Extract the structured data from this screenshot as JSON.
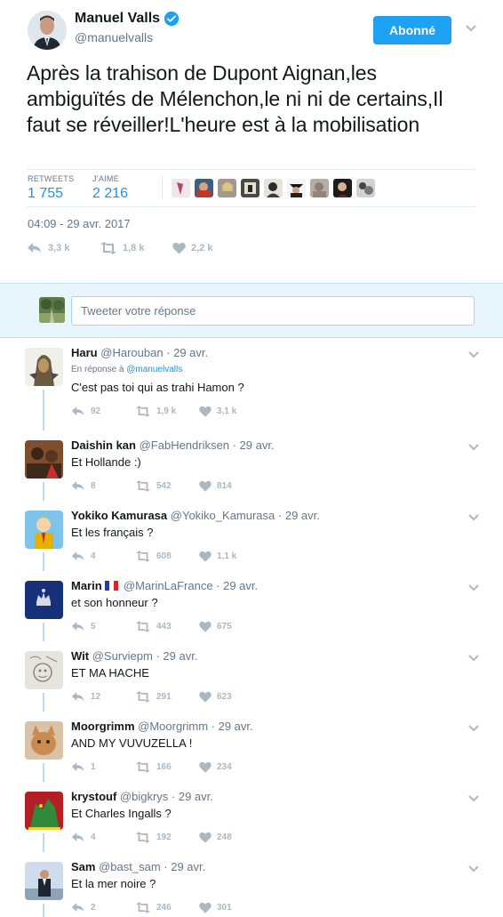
{
  "main_tweet": {
    "author": {
      "name": "Manuel Valls",
      "handle": "@manuelvalls"
    },
    "follow_label": "Abonné",
    "text": "Après la trahison de Dupont Aignan,les ambiguïtés de Mélenchon,le ni ni de certains,Il faut se réveiller!L'heure est à la mobilisation",
    "stats": {
      "retweets_label": "RETWEETS",
      "retweets_value": "1 755",
      "likes_label": "J'AIME",
      "likes_value": "2 216"
    },
    "timestamp": "04:09 - 29 avr. 2017",
    "actions": {
      "reply": "3,3 k",
      "retweet": "1,8 k",
      "like": "2,2 k"
    }
  },
  "reply_box": {
    "placeholder": "Tweeter votre réponse"
  },
  "replies": [
    {
      "name": "Haru",
      "handle": "@Harouban",
      "sep": " · ",
      "date": "29 avr.",
      "in_reply_prefix": "En réponse à ",
      "in_reply_handle": "@manuelvalls",
      "text": "C'est pas toi qui as trahi Hamon ?",
      "reply_count": "92",
      "retweet_count": "1,9 k",
      "like_count": "3,1 k"
    },
    {
      "name": "Daishin kan",
      "handle": "@FabHendriksen",
      "sep": " · ",
      "date": "29 avr.",
      "text": "Et Hollande :)",
      "reply_count": "8",
      "retweet_count": "542",
      "like_count": "814"
    },
    {
      "name": "Yokiko Kamurasa",
      "handle": "@Yokiko_Kamurasa",
      "sep": " · ",
      "date": "29 avr.",
      "text": "Et les français ?",
      "reply_count": "4",
      "retweet_count": "608",
      "like_count": "1,1 k"
    },
    {
      "name": "Marin",
      "handle": "@MarinLaFrance",
      "sep": " · ",
      "date": "29 avr.",
      "text": "et son honneur ?",
      "reply_count": "5",
      "retweet_count": "443",
      "like_count": "675"
    },
    {
      "name": "Wit",
      "handle": "@Surviepm",
      "sep": " · ",
      "date": "29 avr.",
      "text": "ET MA HACHE",
      "reply_count": "12",
      "retweet_count": "291",
      "like_count": "623"
    },
    {
      "name": "Moorgrimm",
      "handle": "@Moorgrimm",
      "sep": " · ",
      "date": "29 avr.",
      "text": "AND MY VUVUZELLA !",
      "reply_count": "1",
      "retweet_count": "166",
      "like_count": "234"
    },
    {
      "name": "krystouf",
      "handle": "@bigkrys",
      "sep": " · ",
      "date": "29 avr.",
      "text": "Et Charles Ingalls ?",
      "reply_count": "4",
      "retweet_count": "192",
      "like_count": "248"
    },
    {
      "name": "Sam",
      "handle": "@bast_sam",
      "sep": " · ",
      "date": "29 avr.",
      "text": "Et la mer noire ?",
      "reply_count": "2",
      "retweet_count": "246",
      "like_count": "301"
    }
  ],
  "colors": {
    "accent": "#1da1f2",
    "link": "#1b95e0",
    "muted": "#657786",
    "icon": "#aab8c2"
  }
}
